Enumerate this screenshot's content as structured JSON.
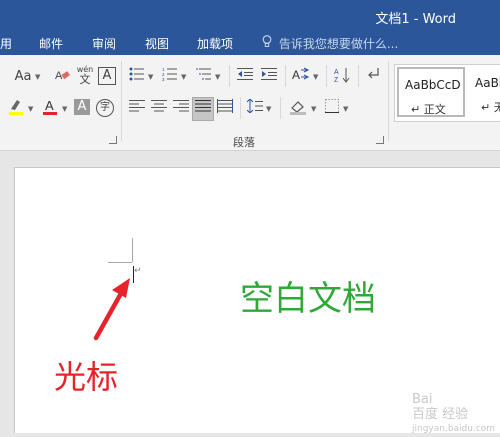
{
  "window": {
    "title": "文档1 - Word"
  },
  "tabs": [
    {
      "label": "用"
    },
    {
      "label": "邮件"
    },
    {
      "label": "审阅"
    },
    {
      "label": "视图"
    },
    {
      "label": "加载项"
    }
  ],
  "tell_me": {
    "placeholder": "告诉我您想要做什么..."
  },
  "ribbon": {
    "font_size_label": "Aa",
    "phonetic_label": "wén",
    "border_a_label": "A",
    "text_effect_label": "A",
    "shading_a_label": "A",
    "enclose_label": "字",
    "paragraph_group_label": "段落",
    "styles": [
      {
        "sample": "AaBbCcD",
        "name": "正文"
      },
      {
        "sample": "AaBbC",
        "name": "无"
      }
    ]
  },
  "document": {
    "blank_label": "空白文档",
    "cursor_label": "光标"
  },
  "colors": {
    "titlebar": "#2b579a",
    "highlight": "#ffff00",
    "font_color": "#e8222a",
    "blank_label": "#2fa836",
    "cursor_label": "#e8222a"
  },
  "watermark": {
    "line1": "Bai",
    "line2": "百度 经验",
    "url": "jingyan.baidu.com"
  }
}
